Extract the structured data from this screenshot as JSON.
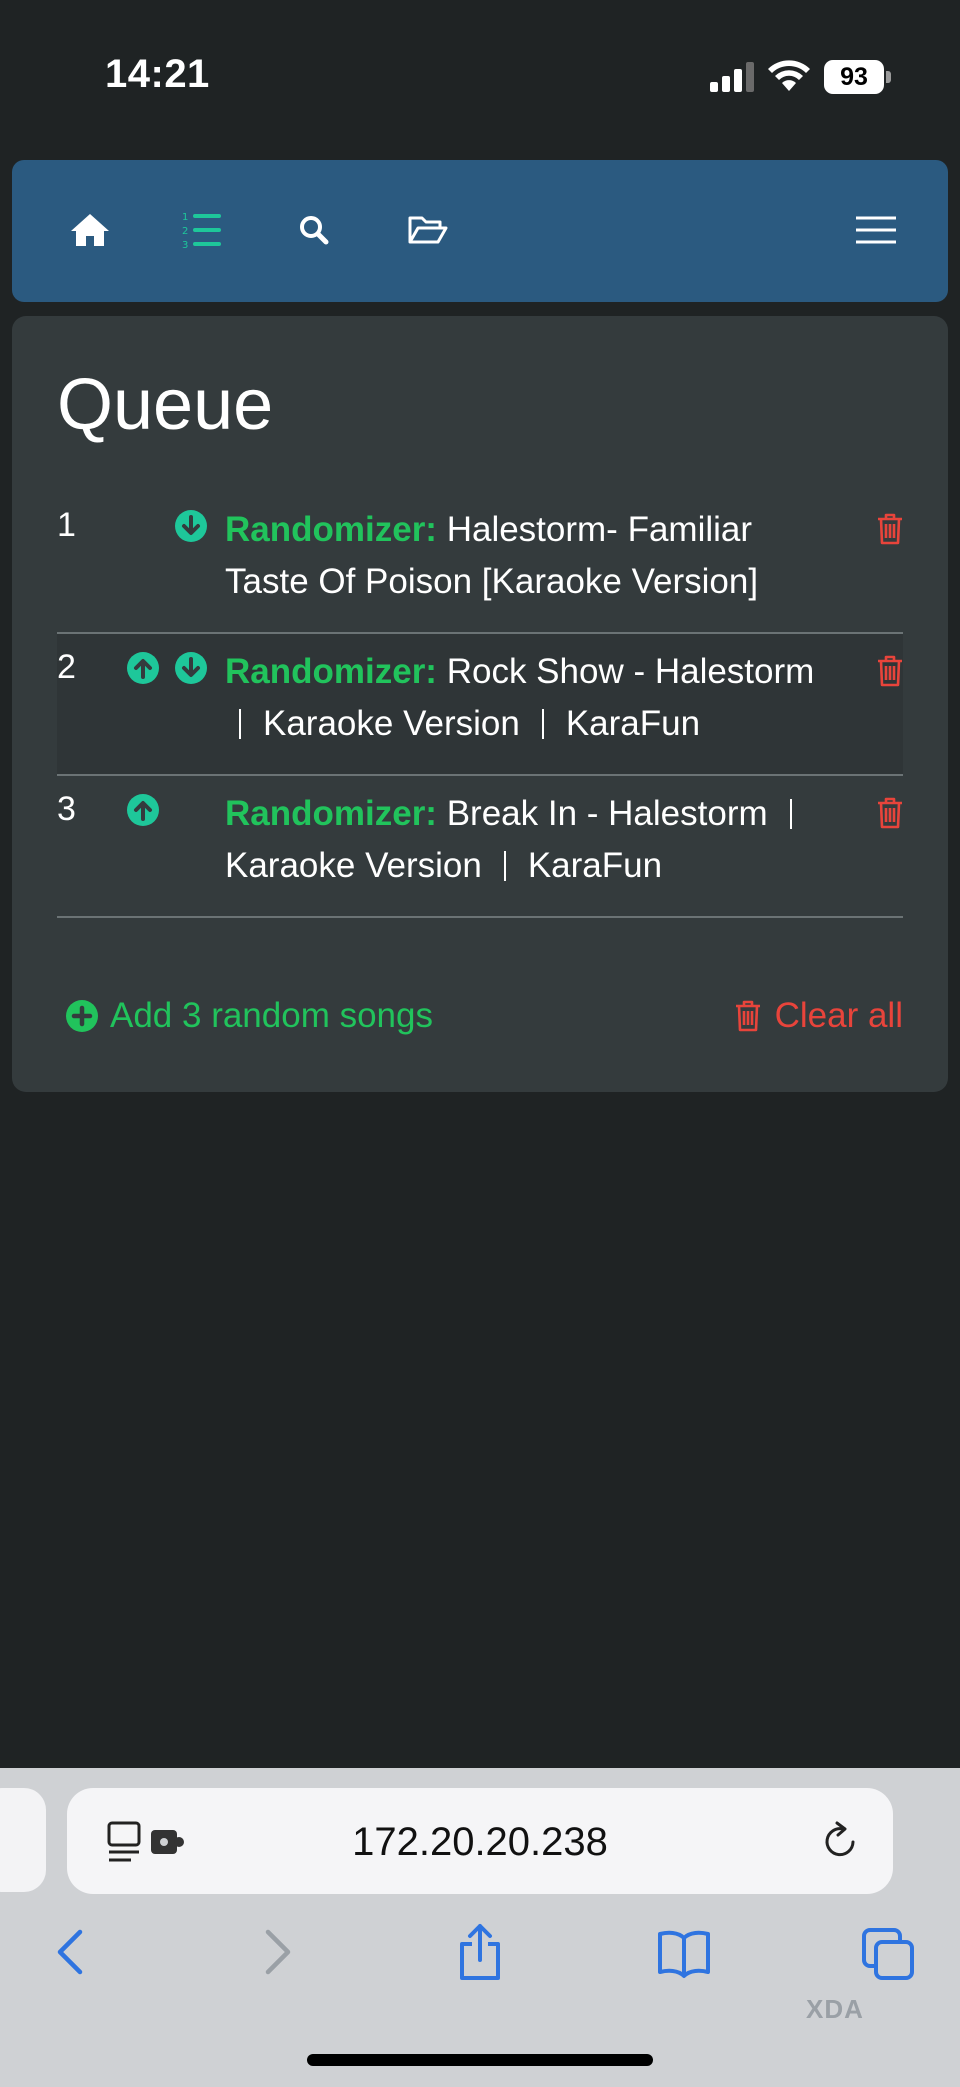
{
  "status": {
    "time": "14:21",
    "battery": "93"
  },
  "navbar": {
    "items": [
      {
        "icon": "home-icon"
      },
      {
        "icon": "numbered-list-icon"
      },
      {
        "icon": "search-icon"
      },
      {
        "icon": "folder-open-icon"
      },
      {
        "icon": "hamburger-menu-icon"
      }
    ],
    "active": "numbered-list-icon"
  },
  "queue": {
    "title": "Queue",
    "items": [
      {
        "num": "1",
        "prefix": "Randomizer:",
        "line1": "Halestorm- Familiar",
        "line2": "Taste Of Poison [Karaoke Version]",
        "up": false,
        "down": true
      },
      {
        "num": "2",
        "prefix": "Randomizer:",
        "line1": "Rock Show - Halestorm",
        "line2a": "Karaoke Version",
        "line2b": "KaraFun",
        "up": true,
        "down": true
      },
      {
        "num": "3",
        "prefix": "Randomizer:",
        "line1": "Break In - Halestorm",
        "line2a": "Karaoke Version",
        "line2b": "KaraFun",
        "up": true,
        "down": false
      }
    ],
    "add_random_label": "Add 3 random songs",
    "clear_all_label": "Clear all"
  },
  "browser": {
    "url": "172.20.20.238"
  },
  "watermark": "XDA",
  "colors": {
    "navbar": "#2b5a80",
    "accent_green": "#21c35c",
    "teal": "#1ec79a",
    "danger": "#e8443b",
    "card": "#343b3d",
    "background": "#1f2324"
  }
}
